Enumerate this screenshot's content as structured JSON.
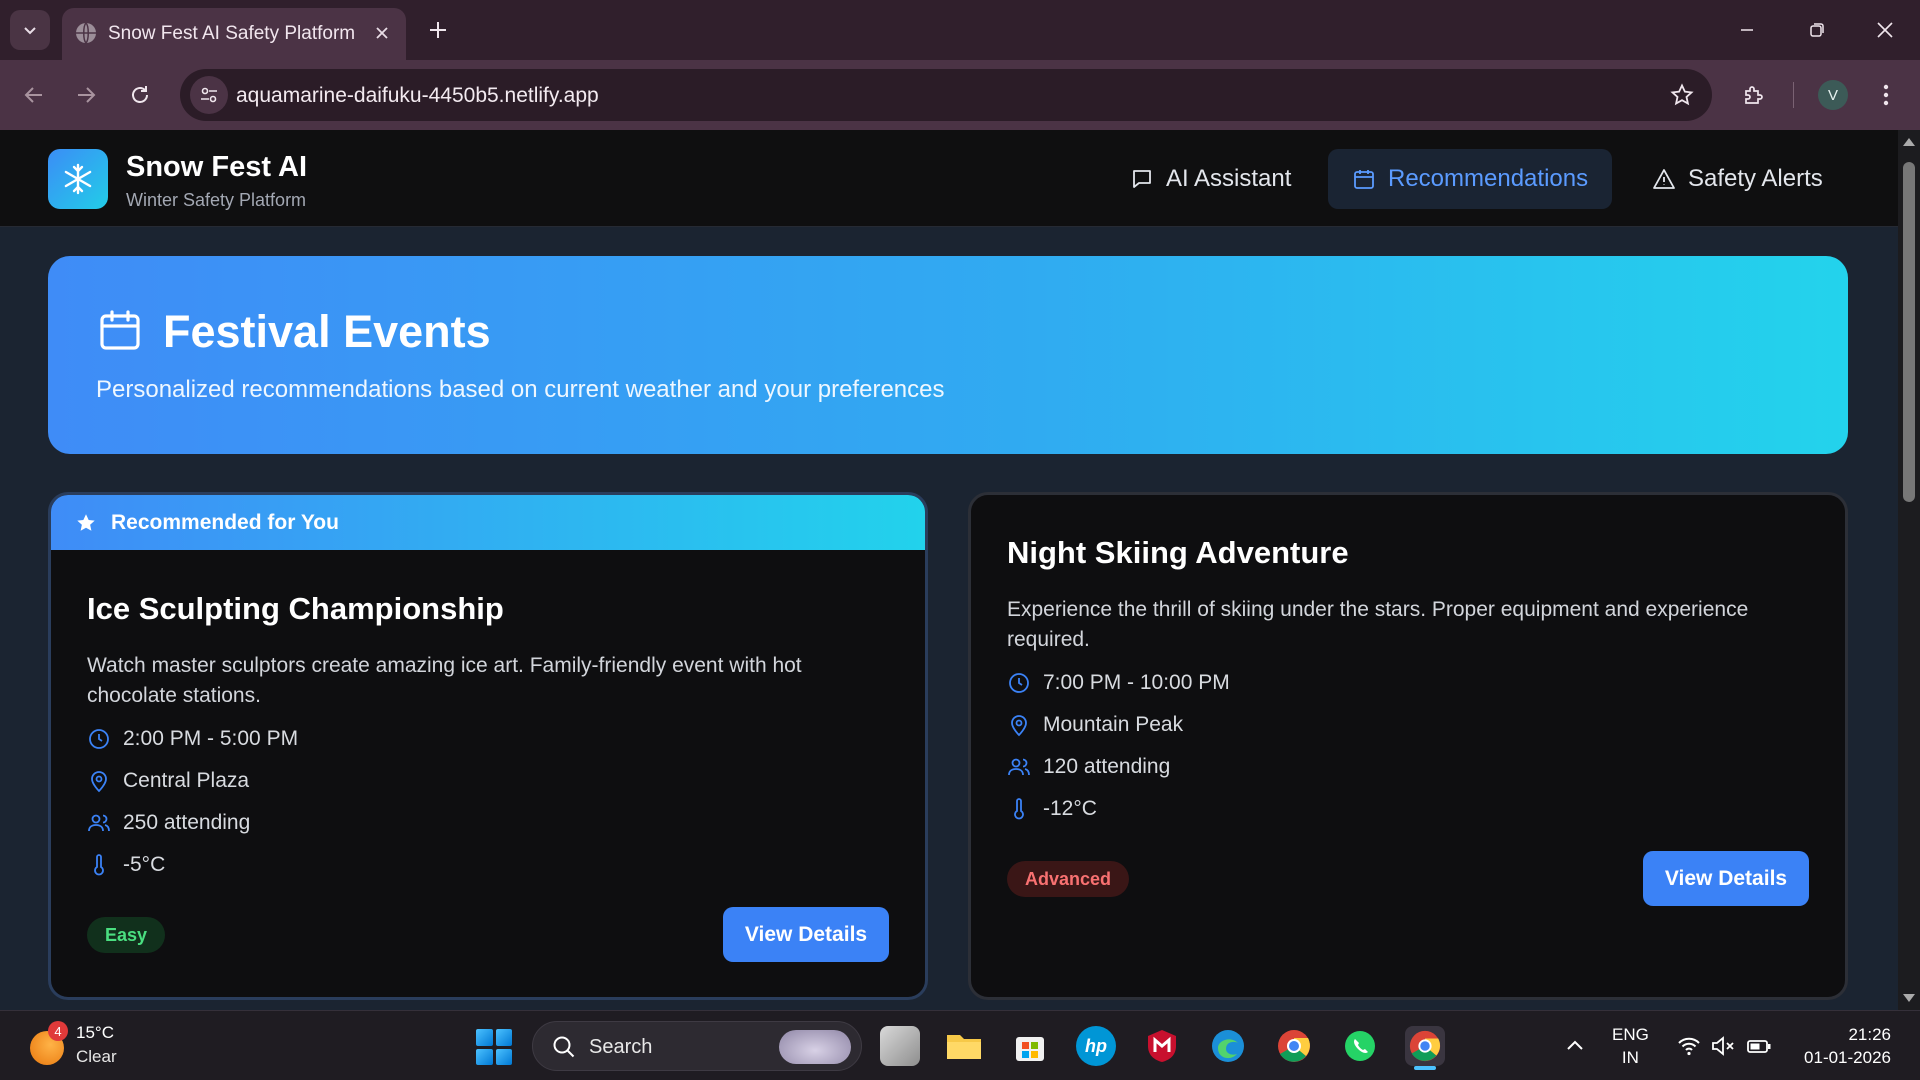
{
  "browser": {
    "tab_title": "Snow Fest AI Safety Platform",
    "url": "aquamarine-daifuku-4450b5.netlify.app",
    "profile_initial": "V"
  },
  "app": {
    "brand_title": "Snow Fest AI",
    "brand_subtitle": "Winter Safety Platform",
    "nav": {
      "assistant": "AI Assistant",
      "recommendations": "Recommendations",
      "alerts": "Safety Alerts"
    },
    "accent_color": "#3b82f6"
  },
  "hero": {
    "title": "Festival Events",
    "subtitle": "Personalized recommendations based on current weather and your preferences"
  },
  "events": [
    {
      "ribbon": "Recommended for You",
      "title": "Ice Sculpting Championship",
      "description": "Watch master sculptors create amazing ice art. Family-friendly event with hot chocolate stations.",
      "time": "2:00 PM - 5:00 PM",
      "location": "Central Plaza",
      "attendance": "250 attending",
      "temperature": "-5°C",
      "difficulty": "Easy",
      "cta": "View Details"
    },
    {
      "title": "Night Skiing Adventure",
      "description": "Experience the thrill of skiing under the stars. Proper equipment and experience required.",
      "time": "7:00 PM - 10:00 PM",
      "location": "Mountain Peak",
      "attendance": "120 attending",
      "temperature": "-12°C",
      "difficulty": "Advanced",
      "cta": "View Details"
    }
  ],
  "taskbar": {
    "weather_badge": "4",
    "weather_temp": "15°C",
    "weather_condition": "Clear",
    "search_label": "Search",
    "lang_line1": "ENG",
    "lang_line2": "IN",
    "time": "21:26",
    "date": "01-01-2026"
  }
}
